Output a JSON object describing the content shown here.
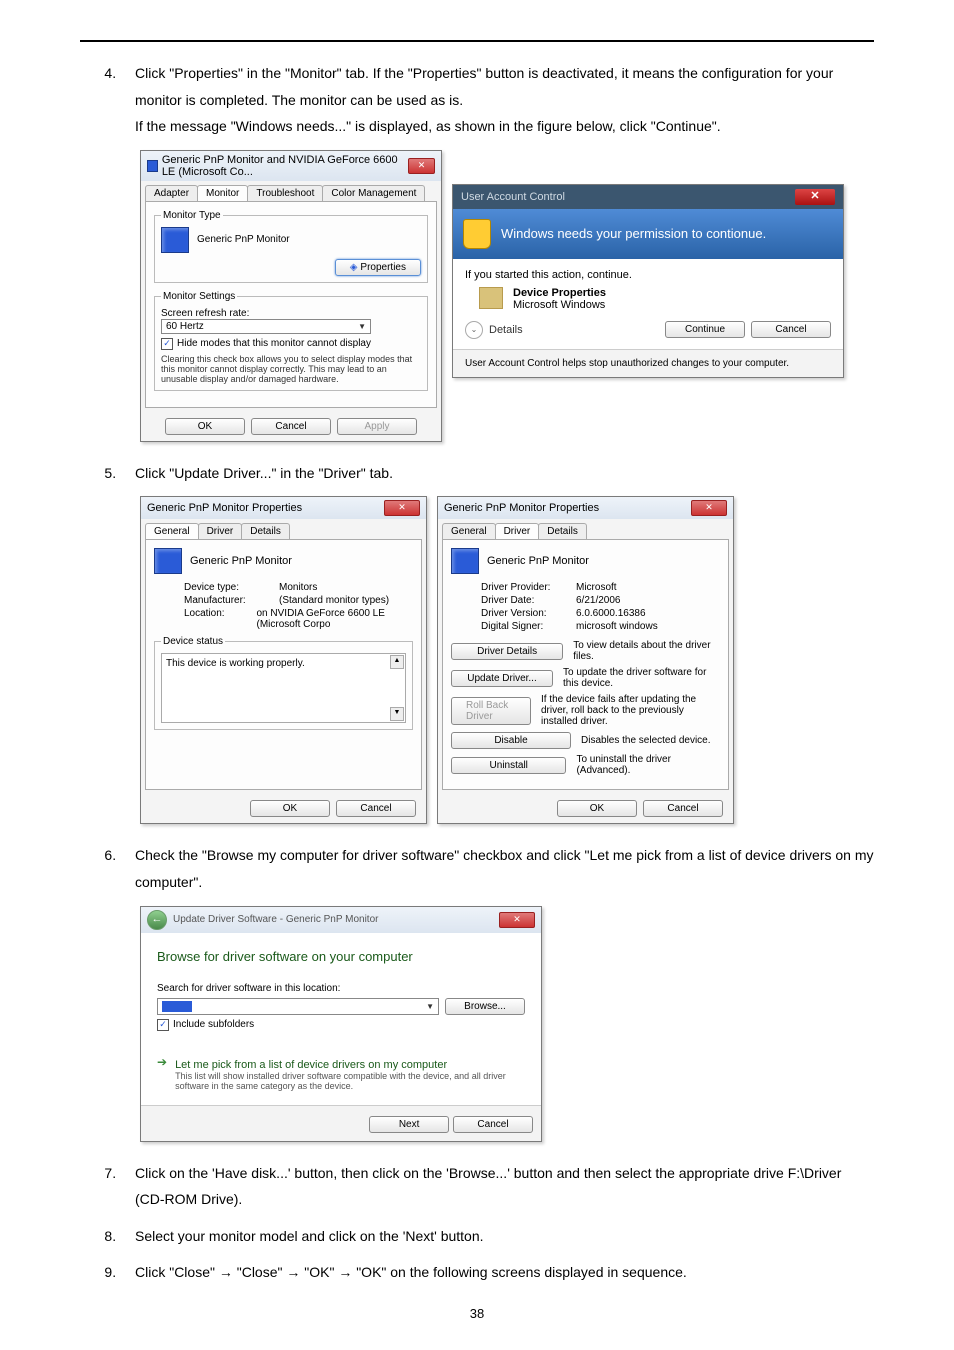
{
  "steps": {
    "s4": {
      "num": "4.",
      "text_a": "Click \"Properties\" in the \"Monitor\" tab. If the \"Properties\" button is deactivated, it means the configuration for your monitor is completed. The monitor can be used as is.",
      "text_b": "If the message \"Windows needs...\" is displayed, as shown in the figure below, click \"Continue\"."
    },
    "s5": {
      "num": "5.",
      "text": "Click \"Update Driver...\" in the \"Driver\" tab."
    },
    "s6": {
      "num": "6.",
      "text": "Check the \"Browse my computer for driver software\" checkbox and click \"Let me pick from a list of device drivers on my computer\"."
    },
    "s7": {
      "num": "7.",
      "text": "Click on the 'Have disk...' button, then click on the 'Browse...' button and then select the appropriate drive F:\\Driver (CD-ROM Drive)."
    },
    "s8": {
      "num": "8.",
      "text": "Select your monitor model and click on the 'Next' button."
    },
    "s9": {
      "num": "9.",
      "p1": "Click \"Close\"  ",
      "p2": "  \"Close\"  ",
      "p3": "  \"OK\"  ",
      "p4": "  \"OK\" on the following screens displayed in sequence.",
      "arrow": "→"
    }
  },
  "fig1": {
    "title": "Generic PnP Monitor and NVIDIA GeForce 6600 LE (Microsoft Co...",
    "tabs": [
      "Adapter",
      "Monitor",
      "Troubleshoot",
      "Color Management"
    ],
    "grp_type": "Monitor Type",
    "mon_name": "Generic PnP Monitor",
    "btn_props": "Properties",
    "grp_set": "Monitor Settings",
    "refresh_lbl": "Screen refresh rate:",
    "refresh_val": "60 Hertz",
    "hide_chk": "Hide modes that this monitor cannot display",
    "hide_desc": "Clearing this check box allows you to select display modes that this monitor cannot display correctly. This may lead to an unusable display and/or damaged hardware.",
    "ok": "OK",
    "cancel": "Cancel",
    "apply": "Apply"
  },
  "uac": {
    "title": "User Account Control",
    "headline": "Windows needs your permission to contionue.",
    "if_started": "If you started this action, continue.",
    "app": "Device Properties",
    "vendor": "Microsoft Windows",
    "details": "Details",
    "continue": "Continue",
    "cancel": "Cancel",
    "footer": "User Account Control helps stop unauthorized changes to your computer."
  },
  "fig2a": {
    "title": "Generic PnP Monitor Properties",
    "tabs": [
      "General",
      "Driver",
      "Details"
    ],
    "name": "Generic PnP Monitor",
    "kv": [
      {
        "k": "Device type:",
        "v": "Monitors"
      },
      {
        "k": "Manufacturer:",
        "v": "(Standard monitor types)"
      },
      {
        "k": "Location:",
        "v": "on NVIDIA GeForce 6600 LE (Microsoft Corpo"
      }
    ],
    "status_lbl": "Device status",
    "status_txt": "This device is working properly.",
    "ok": "OK",
    "cancel": "Cancel"
  },
  "fig2b": {
    "title": "Generic PnP Monitor Properties",
    "tabs": [
      "General",
      "Driver",
      "Details"
    ],
    "name": "Generic PnP Monitor",
    "kv": [
      {
        "k": "Driver Provider:",
        "v": "Microsoft"
      },
      {
        "k": "Driver Date:",
        "v": "6/21/2006"
      },
      {
        "k": "Driver Version:",
        "v": "6.0.6000.16386"
      },
      {
        "k": "Digital Signer:",
        "v": "microsoft windows"
      }
    ],
    "actions": [
      {
        "b": "Driver Details",
        "t": "To view details about the driver files."
      },
      {
        "b": "Update Driver...",
        "t": "To update the driver software for this device."
      },
      {
        "b": "Roll Back Driver",
        "t": "If the device fails after updating the driver, roll back to the previously installed driver."
      },
      {
        "b": "Disable",
        "t": "Disables the selected device."
      },
      {
        "b": "Uninstall",
        "t": "To uninstall the driver (Advanced)."
      }
    ],
    "ok": "OK",
    "cancel": "Cancel"
  },
  "wiz": {
    "title": "Update Driver Software - Generic PnP Monitor",
    "h": "Browse for driver software on your computer",
    "search_lbl": "Search for driver software in this location:",
    "path": "",
    "browse": "Browse...",
    "include": "Include subfolders",
    "opt_title": "Let me pick from a list of device drivers on my computer",
    "opt_sub": "This list will show installed driver software compatible with the device, and all driver software in the same category as the device.",
    "next": "Next",
    "cancel": "Cancel"
  },
  "page": "38"
}
